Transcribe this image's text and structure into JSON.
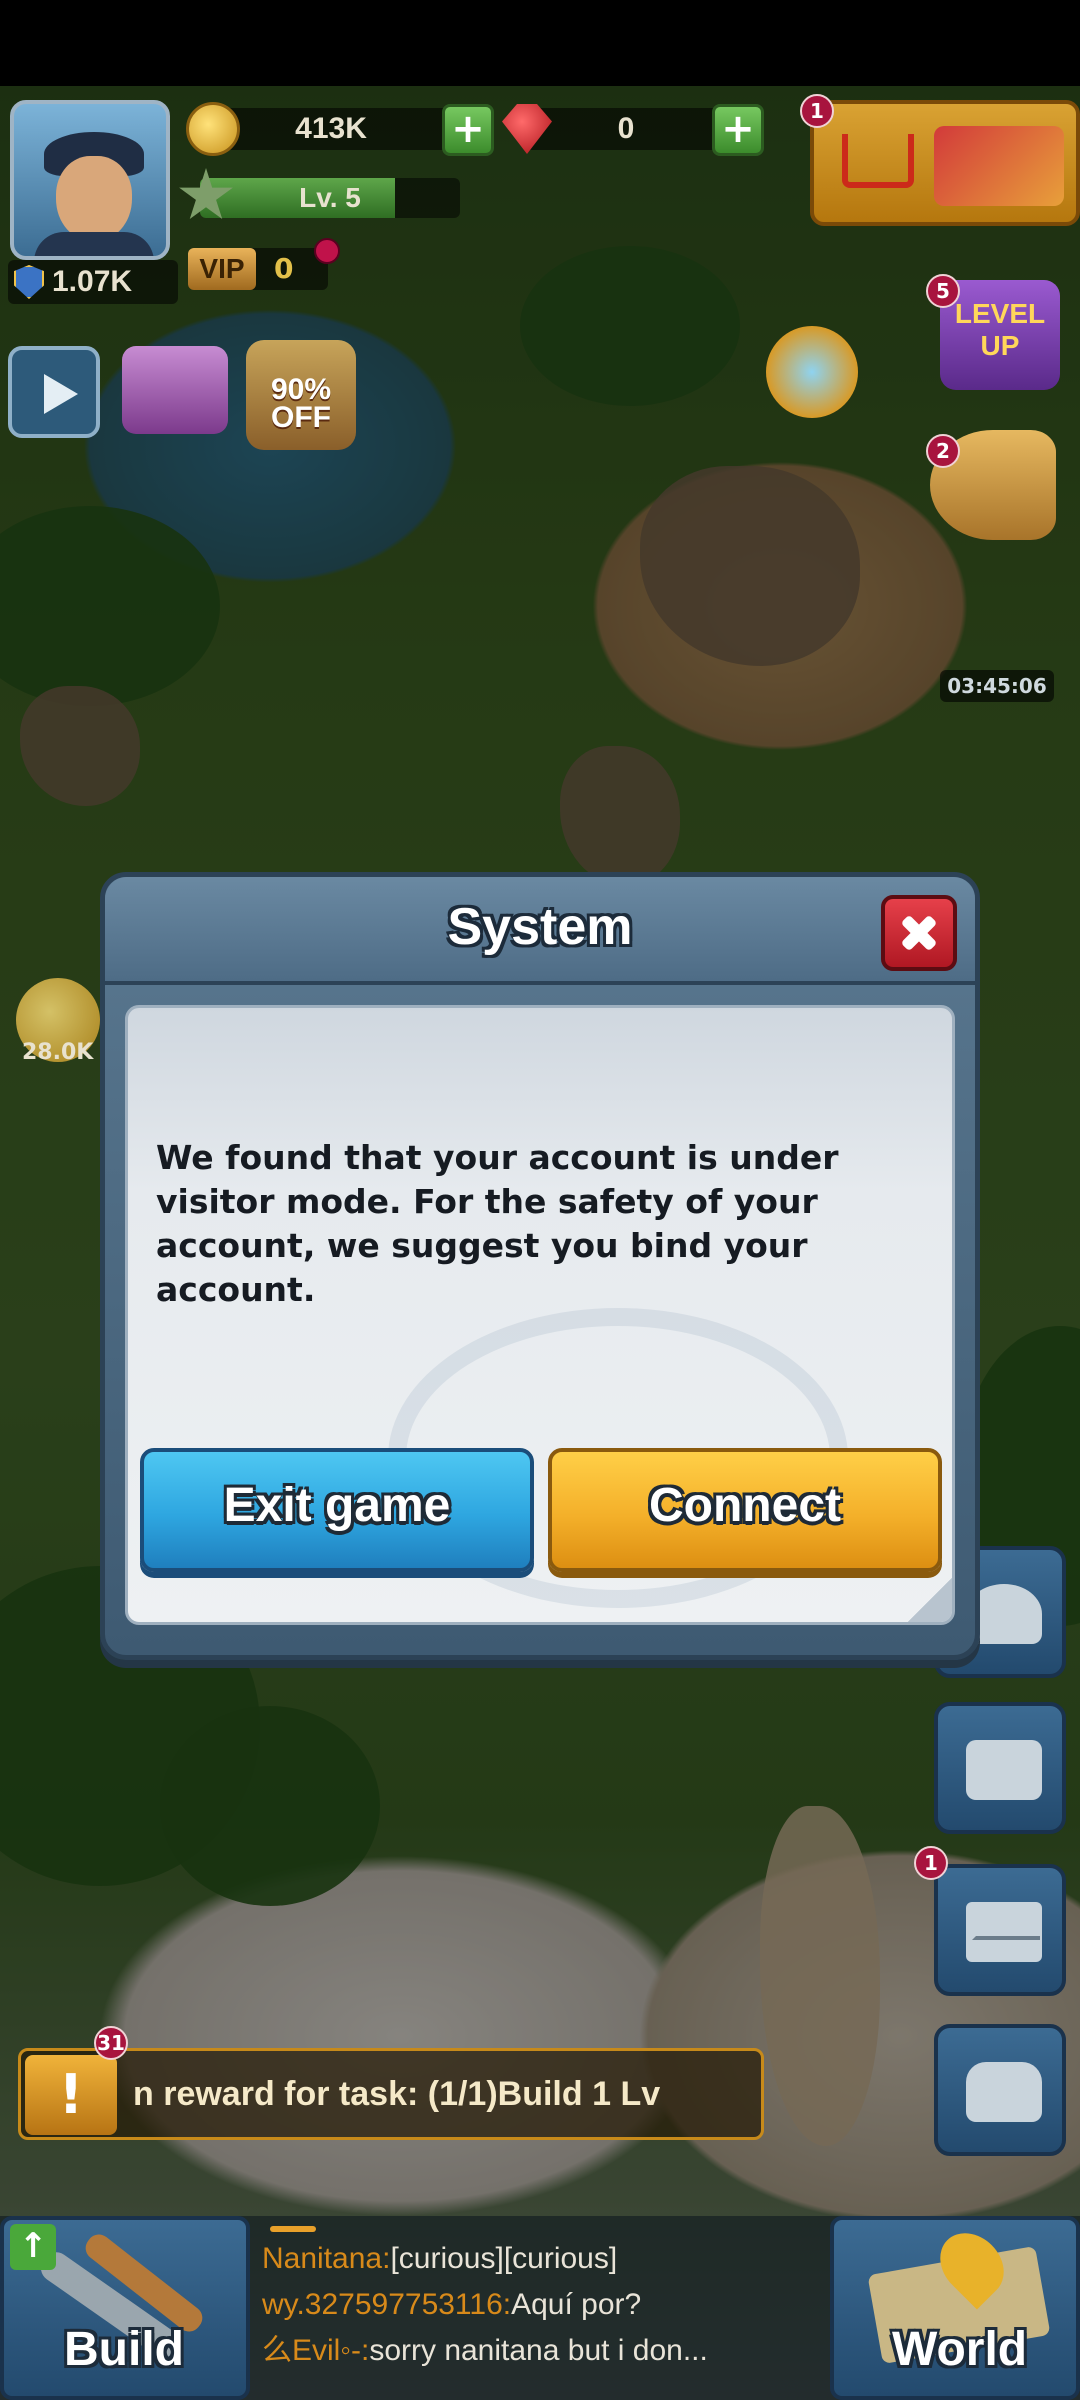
{
  "hud": {
    "power": "1.07K",
    "coins": "413K",
    "gems": "0",
    "level": "Lv. 5",
    "level_progress": 0.75,
    "vip_label": "VIP",
    "vip_value": "0",
    "shop_badge": "1"
  },
  "side_icons": {
    "discount": "90%\nOFF",
    "level_up": "LEVEL UP",
    "level_up_badge": "5",
    "megaphone_badge": "2",
    "timer": "03:45:06",
    "coin_pile_amount": "28.0K"
  },
  "dialog": {
    "title": "System",
    "message": "We found that your account is under visitor mode. For the safety of your account, we suggest you bind your account.",
    "exit_label": "Exit game",
    "connect_label": "Connect"
  },
  "dock": {
    "mail_badge": "1"
  },
  "task": {
    "badge": "31",
    "icon": "!",
    "text": "n reward for task: (1/1)Build 1 Lv"
  },
  "bottom": {
    "build_label": "Build",
    "world_label": "World"
  },
  "chat": [
    {
      "name": "Nanitana:",
      "message": "[curious][curious]"
    },
    {
      "name": "wy.327597753116:",
      "message": "Aquí por?"
    },
    {
      "name": "么Evil◦-:",
      "message": "sorry nanitana but i don..."
    }
  ],
  "colors": {
    "exit_button": "#2ea6e0",
    "connect_button": "#f4b02a",
    "close_button": "#b01823",
    "dialog_frame": "#4e6c86"
  }
}
